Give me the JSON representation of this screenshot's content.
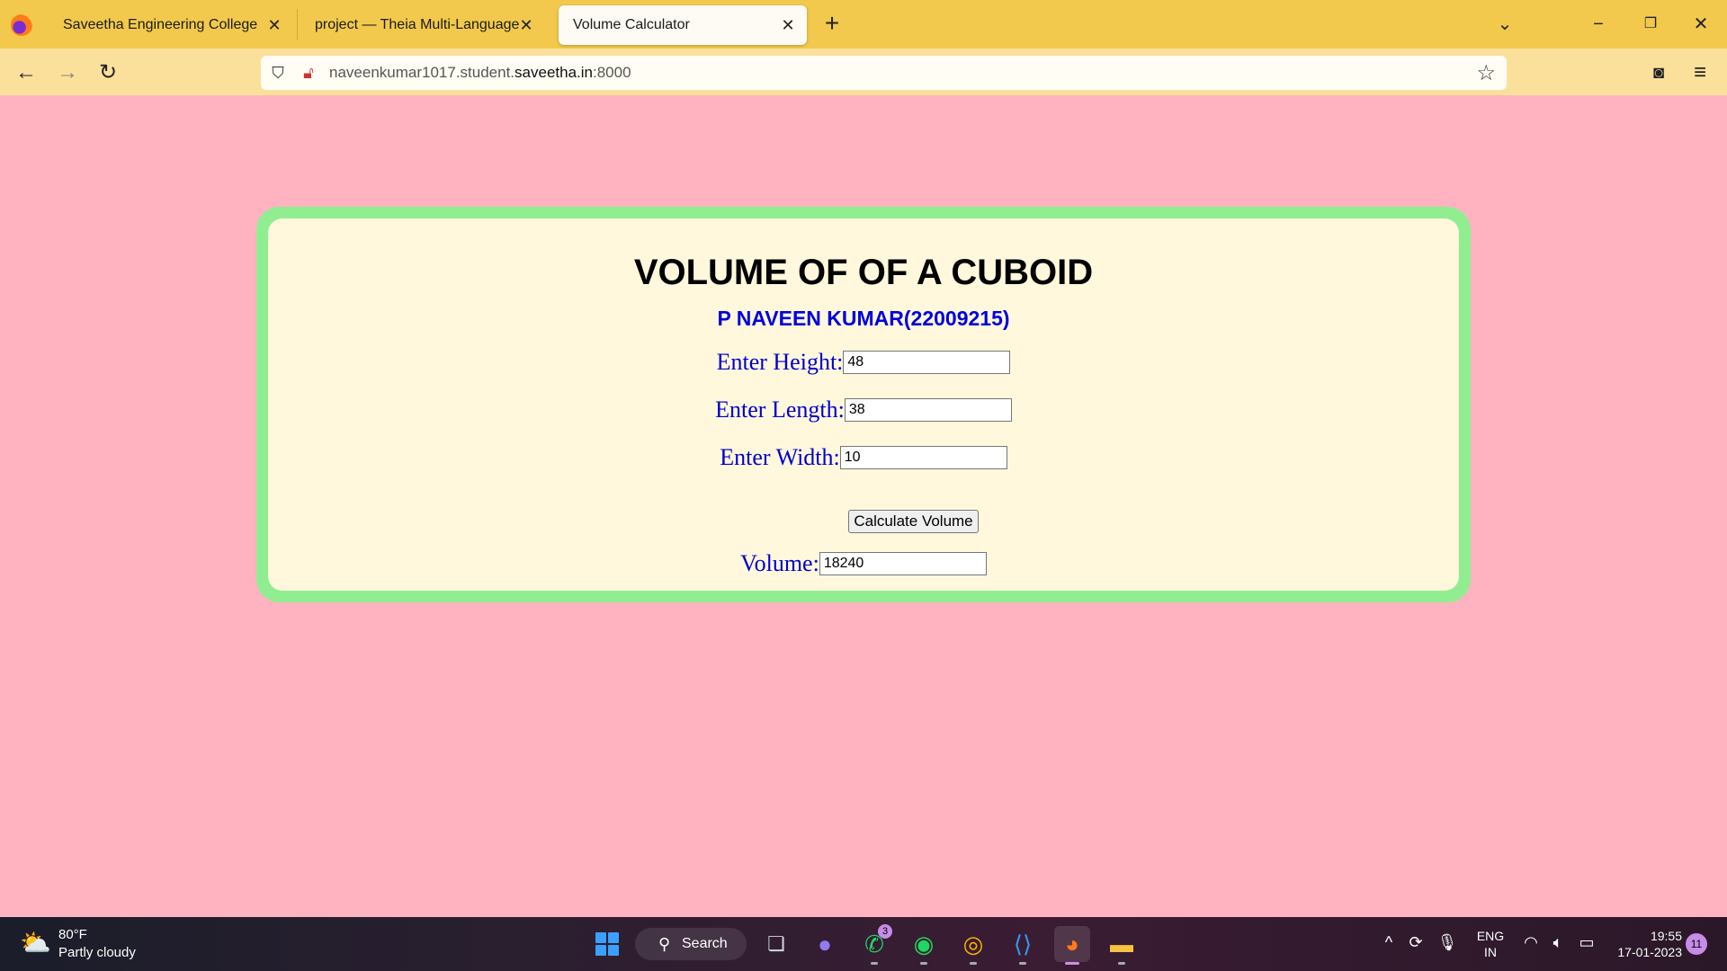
{
  "browser": {
    "tabs": [
      {
        "label": "Saveetha Engineering College",
        "active": false
      },
      {
        "label": "project — Theia Multi-Language Ex",
        "active": false
      },
      {
        "label": "Volume Calculator",
        "active": true
      }
    ],
    "url": {
      "prefix": "naveenkumar1017.student.",
      "host": "saveetha.in",
      "suffix": ":8000"
    }
  },
  "page": {
    "title": "VOLUME OF OF A CUBOID",
    "author": "P NAVEEN KUMAR(22009215)",
    "fields": {
      "height": {
        "label": "Enter Height:",
        "value": "48"
      },
      "length": {
        "label": "Enter Length:",
        "value": "38"
      },
      "width": {
        "label": "Enter Width:",
        "value": "10"
      }
    },
    "button_label": "Calculate Volume",
    "result": {
      "label": "Volume:",
      "value": "18240"
    }
  },
  "colors": {
    "page_bg": "#ffb3c1",
    "card_border": "#90ee90",
    "card_bg": "#fff8dc",
    "label_blue": "#0000cc",
    "tabbar": "#f2c94c",
    "navbar": "#fbe09c"
  },
  "taskbar": {
    "weather_temp": "80°F",
    "weather_desc": "Partly cloudy",
    "search_label": "Search",
    "whatsapp_badge": "3",
    "lang_line1": "ENG",
    "lang_line2": "IN",
    "time": "19:55",
    "date": "17-01-2023",
    "notifications": "11"
  }
}
